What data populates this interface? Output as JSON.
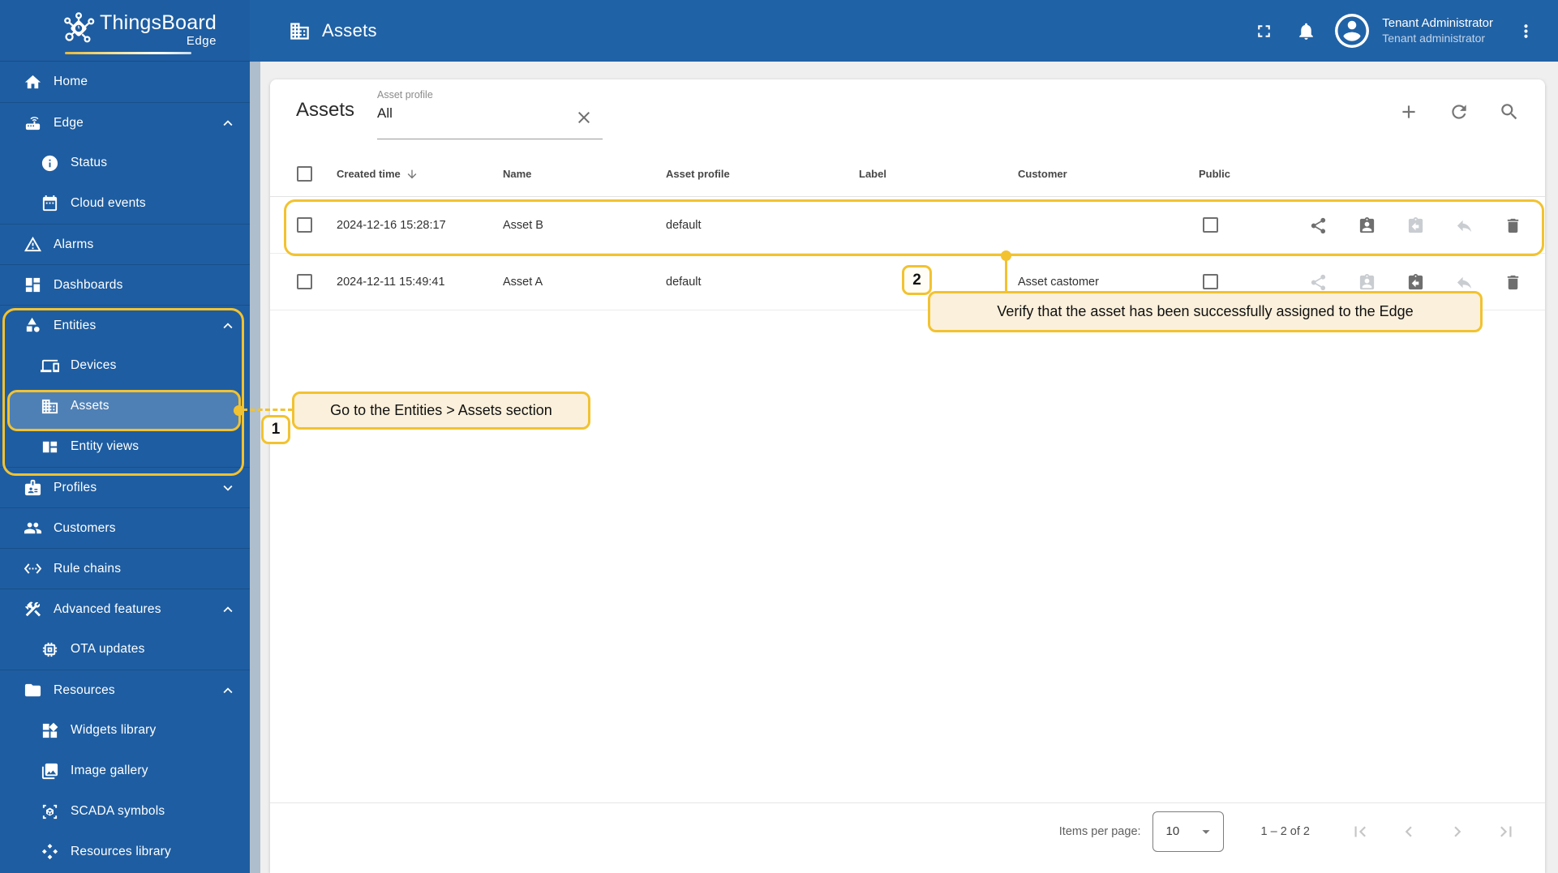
{
  "colors": {
    "primary_blue": "#2062A6",
    "sidebar_blue": "#1E5DA1",
    "annotation_yellow": "#F2C230",
    "callout_bg": "#FBF0DB"
  },
  "sidebar": {
    "logo_title": "ThingsBoard",
    "logo_subtitle": "Edge",
    "items": [
      {
        "label": "Home",
        "icon": "home",
        "level": 0
      },
      {
        "label": "Edge",
        "icon": "router",
        "level": 0,
        "chevron": "up"
      },
      {
        "label": "Status",
        "icon": "info",
        "level": 1
      },
      {
        "label": "Cloud events",
        "icon": "calendar",
        "level": 1
      },
      {
        "label": "Alarms",
        "icon": "warning",
        "level": 0
      },
      {
        "label": "Dashboards",
        "icon": "dashboard",
        "level": 0
      },
      {
        "label": "Entities",
        "icon": "shapes",
        "level": 0,
        "chevron": "up"
      },
      {
        "label": "Devices",
        "icon": "devices",
        "level": 1
      },
      {
        "label": "Assets",
        "icon": "building",
        "level": 1,
        "selected": true
      },
      {
        "label": "Entity views",
        "icon": "view-quilt",
        "level": 1
      },
      {
        "label": "Profiles",
        "icon": "badge",
        "level": 0,
        "chevron": "down"
      },
      {
        "label": "Customers",
        "icon": "people",
        "level": 0
      },
      {
        "label": "Rule chains",
        "icon": "rule-chain",
        "level": 0
      },
      {
        "label": "Advanced features",
        "icon": "tools",
        "level": 0,
        "chevron": "up"
      },
      {
        "label": "OTA updates",
        "icon": "chip",
        "level": 1
      },
      {
        "label": "Resources",
        "icon": "folder",
        "level": 0,
        "chevron": "up"
      },
      {
        "label": "Widgets library",
        "icon": "widgets",
        "level": 1
      },
      {
        "label": "Image gallery",
        "icon": "image",
        "level": 1
      },
      {
        "label": "SCADA symbols",
        "icon": "scada",
        "level": 1
      },
      {
        "label": "Resources library",
        "icon": "diamonds",
        "level": 1
      }
    ]
  },
  "header": {
    "title": "Assets",
    "user_name": "Tenant Administrator",
    "user_role": "Tenant administrator"
  },
  "toolbar": {
    "table_title": "Assets",
    "filter_label": "Asset profile",
    "filter_value": "All"
  },
  "table": {
    "columns": [
      "Created time",
      "Name",
      "Asset profile",
      "Label",
      "Customer",
      "Public"
    ],
    "sorted_column": "Created time",
    "rows": [
      {
        "created_time": "2024-12-16 15:28:17",
        "name": "Asset B",
        "asset_profile": "default",
        "label": "",
        "customer": "",
        "public": false,
        "actions_active": [
          true,
          true,
          false,
          false,
          true
        ]
      },
      {
        "created_time": "2024-12-11 15:49:41",
        "name": "Asset A",
        "asset_profile": "default",
        "label": "",
        "customer": "Asset castomer",
        "public": false,
        "actions_active": [
          false,
          false,
          true,
          false,
          true
        ]
      }
    ]
  },
  "footer": {
    "items_per_page_label": "Items per page:",
    "items_per_page_value": "10",
    "range_label": "1 – 2 of 2"
  },
  "annotations": {
    "step1": {
      "number": "1",
      "text": "Go to the Entities > Assets section"
    },
    "step2": {
      "number": "2",
      "text": "Verify that the asset has been successfully assigned to the Edge"
    }
  }
}
